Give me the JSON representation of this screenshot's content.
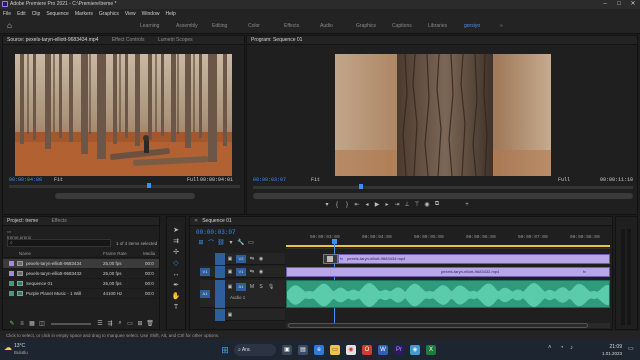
{
  "window": {
    "title": "Adobe Premiere Pro 2021 - C:\\Premiere\\treme *",
    "minimize_glyph": "–",
    "maximize_glyph": "□",
    "close_glyph": "✕"
  },
  "menu": [
    "File",
    "Edit",
    "Clip",
    "Sequence",
    "Markers",
    "Graphics",
    "View",
    "Window",
    "Help"
  ],
  "workspaces": {
    "items": [
      "Learning",
      "Assembly",
      "Editing",
      "Color",
      "Effects",
      "Audio",
      "Graphics",
      "Captions",
      "Libraries",
      "gorsiyo"
    ],
    "active_index": 9,
    "overflow": "»"
  },
  "source_monitor": {
    "tab_label": "Source: pexels-taryn-elliott-9683434.mp4",
    "tabs": [
      "Effect Controls",
      "Lumetri Scopes"
    ],
    "timecode_in": "00:00:04:00",
    "fit": "Fit",
    "quality": "Full",
    "timecode_out": "00:00:04:01"
  },
  "program_monitor": {
    "tab_label": "Program: Sequence 01",
    "timecode_in": "00:00:03:07",
    "fit": "Fit",
    "quality": "Full",
    "timecode_out": "00:00:11:10"
  },
  "project": {
    "tab_label": "Project: treme",
    "tabs": [
      "Effects"
    ],
    "file": "treme.prproj",
    "selected": "1 of 4 items selected",
    "columns": [
      "Name",
      "Frame Rate",
      "Media"
    ],
    "items": [
      {
        "name": "pexels-taryn-elliott-9683434",
        "rate": "25,00 fps",
        "media": "00:0",
        "color": "#a58bd6"
      },
      {
        "name": "pexels-taryn-elliott-9683432",
        "rate": "25,00 fps",
        "media": "00:0",
        "color": "#a58bd6"
      },
      {
        "name": "Sequence 01",
        "rate": "25,00 fps",
        "media": "00:0",
        "color": "#3aa27a"
      },
      {
        "name": "Purple Planet Music - 1 Will",
        "rate": "44100 Hz",
        "media": "00:0",
        "color": "#3aa27a"
      }
    ]
  },
  "timeline": {
    "tab_label": "Sequence 01",
    "timecode": "00:00:03:07",
    "ruler": [
      "00:00:03:00",
      "00:00:04:00",
      "00:00:05:00",
      "00:00:06:00",
      "00:00:07:00",
      "00:00:08:00"
    ],
    "tracks": {
      "v2": "V2",
      "v1": "V1",
      "v1src": "V1",
      "a1": "A1",
      "a1src": "A1",
      "audio_name": "Audio 1"
    },
    "clips": {
      "v2": "pexels-taryn-elliott-9683434.mp4",
      "v1": "pexels-taryn-elliott-9683432.mp4"
    },
    "tag_labels": [
      "fx",
      "fx"
    ]
  },
  "status_bar": "Click to select, or click in empty space and drag to marquee select. Use Shift, Alt, and Ctrl for other options.",
  "taskbar": {
    "weather_temp": "13°C",
    "weather_desc": "Bulutlu",
    "search": "Ara",
    "time": "21:09",
    "date": "1.01.2023"
  }
}
